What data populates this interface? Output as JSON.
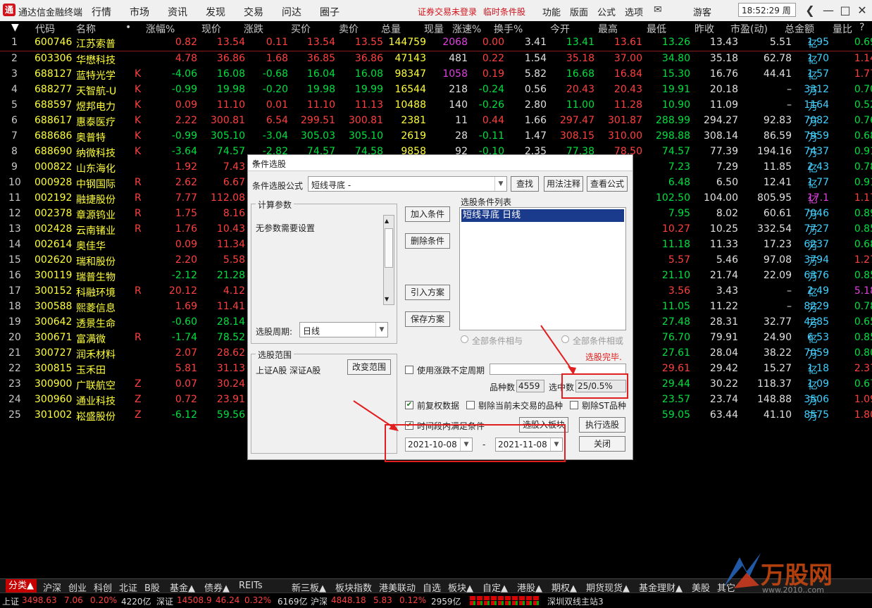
{
  "app": {
    "title": "通达信金融终端",
    "logo": "通",
    "menu": [
      "行情",
      "市场",
      "资讯",
      "发现",
      "交易",
      "问达",
      "圈子"
    ],
    "warning1": "证券交易未登录",
    "warning2": "临时条件股",
    "menu2": [
      "功能",
      "版面",
      "公式",
      "选项"
    ],
    "mail_icon": "✉",
    "guest": "游客",
    "clock": "18:52:29 周一",
    "win_back": "❮",
    "win_min": "—",
    "win_max": "□",
    "win_close": "✕"
  },
  "table": {
    "sort_marker": "▼",
    "headers": [
      "代码",
      "名称",
      "•",
      "涨幅%",
      "现价",
      "涨跌",
      "买价",
      "卖价",
      "总量",
      "现量",
      "涨速%",
      "换手%",
      "今开",
      "最高",
      "最低",
      "昨收",
      "市盈(动)",
      "总金额",
      "量比",
      "?"
    ],
    "rows": [
      {
        "no": "1",
        "code": "600746",
        "name": "江苏索普",
        "flag": "",
        "chg": "0.82",
        "price": "13.54",
        "diff": "0.11",
        "bid": "13.54",
        "ask": "13.55",
        "vol": "144759",
        "cur": "2068",
        "spd": "0.00",
        "turn": "3.41",
        "open": "13.41",
        "high": "13.61",
        "low": "13.26",
        "prev": "13.43",
        "pe": "5.51",
        "amt": "1.95",
        "amt_unit": "亿",
        "ratio": "0.69"
      },
      {
        "no": "2",
        "code": "603306",
        "name": "华懋科技",
        "flag": "",
        "chg": "4.78",
        "price": "36.86",
        "diff": "1.68",
        "bid": "36.85",
        "ask": "36.86",
        "vol": "47143",
        "cur": "481",
        "spd": "0.22",
        "turn": "1.54",
        "open": "35.18",
        "high": "37.00",
        "low": "34.80",
        "prev": "35.18",
        "pe": "62.78",
        "amt": "1.70",
        "amt_unit": "亿",
        "ratio": "1.14"
      },
      {
        "no": "3",
        "code": "688127",
        "name": "蓝特光学",
        "flag": "K",
        "chg": "-4.06",
        "price": "16.08",
        "diff": "-0.68",
        "bid": "16.04",
        "ask": "16.08",
        "vol": "98347",
        "cur": "1058",
        "spd": "0.19",
        "turn": "5.82",
        "open": "16.68",
        "high": "16.84",
        "low": "15.30",
        "prev": "16.76",
        "pe": "44.41",
        "amt": "1.57",
        "amt_unit": "亿",
        "ratio": "1.77"
      },
      {
        "no": "4",
        "code": "688277",
        "name": "天智航-U",
        "flag": "K",
        "chg": "-0.99",
        "price": "19.98",
        "diff": "-0.20",
        "bid": "19.98",
        "ask": "19.99",
        "vol": "16544",
        "cur": "218",
        "spd": "-0.24",
        "turn": "0.56",
        "open": "20.43",
        "high": "20.43",
        "low": "19.91",
        "prev": "20.18",
        "pe": "–",
        "amt": "3312",
        "amt_unit": "万",
        "ratio": "0.70"
      },
      {
        "no": "5",
        "code": "688597",
        "name": "煜邦电力",
        "flag": "K",
        "chg": "0.09",
        "price": "11.10",
        "diff": "0.01",
        "bid": "11.10",
        "ask": "11.13",
        "vol": "10488",
        "cur": "140",
        "spd": "-0.26",
        "turn": "2.80",
        "open": "11.00",
        "high": "11.28",
        "low": "10.90",
        "prev": "11.09",
        "pe": "–",
        "amt": "1164",
        "amt_unit": "万",
        "ratio": "0.52"
      },
      {
        "no": "6",
        "code": "688617",
        "name": "惠泰医疗",
        "flag": "K",
        "chg": "2.22",
        "price": "300.81",
        "diff": "6.54",
        "bid": "299.51",
        "ask": "300.81",
        "vol": "2381",
        "cur": "11",
        "spd": "0.44",
        "turn": "1.66",
        "open": "297.47",
        "high": "301.87",
        "low": "288.99",
        "prev": "294.27",
        "pe": "92.83",
        "amt": "7082",
        "amt_unit": "万",
        "ratio": "0.76"
      },
      {
        "no": "7",
        "code": "688686",
        "name": "奥普特",
        "flag": "K",
        "chg": "-0.99",
        "price": "305.10",
        "diff": "-3.04",
        "bid": "305.03",
        "ask": "305.10",
        "vol": "2619",
        "cur": "28",
        "spd": "-0.11",
        "turn": "1.47",
        "open": "308.15",
        "high": "310.00",
        "low": "298.88",
        "prev": "308.14",
        "pe": "86.59",
        "amt": "7959",
        "amt_unit": "万",
        "ratio": "0.68"
      },
      {
        "no": "8",
        "code": "688690",
        "name": "纳微科技",
        "flag": "K",
        "chg": "-3.64",
        "price": "74.57",
        "diff": "-2.82",
        "bid": "74.57",
        "ask": "74.58",
        "vol": "9858",
        "cur": "92",
        "spd": "-0.10",
        "turn": "2.35",
        "open": "77.38",
        "high": "78.50",
        "low": "74.57",
        "prev": "77.39",
        "pe": "194.16",
        "amt": "7437",
        "amt_unit": "万",
        "ratio": "0.91"
      },
      {
        "no": "9",
        "code": "000822",
        "name": "山东海化",
        "flag": "",
        "chg": "1.92",
        "price": "7.43",
        "low": "7.23",
        "prev": "7.29",
        "pe": "11.85",
        "amt": "2.43",
        "amt_unit": "亿",
        "ratio": "0.78"
      },
      {
        "no": "10",
        "code": "000928",
        "name": "中钢国际",
        "flag": "R",
        "chg": "2.62",
        "price": "6.67",
        "low": "6.48",
        "prev": "6.50",
        "pe": "12.41",
        "amt": "1.77",
        "amt_unit": "亿",
        "ratio": "0.91"
      },
      {
        "no": "11",
        "code": "002192",
        "name": "融捷股份",
        "flag": "R",
        "chg": "7.77",
        "price": "112.08",
        "low": "102.50",
        "prev": "104.00",
        "pe": "805.95",
        "amt": "17.1",
        "amt_unit": "亿",
        "ratio": "1.17"
      },
      {
        "no": "12",
        "code": "002378",
        "name": "章源钨业",
        "flag": "R",
        "chg": "1.75",
        "price": "8.16",
        "low": "7.95",
        "prev": "8.02",
        "pe": "60.61",
        "amt": "7046",
        "amt_unit": "万",
        "ratio": "0.89"
      },
      {
        "no": "13",
        "code": "002428",
        "name": "云南锗业",
        "flag": "R",
        "chg": "1.76",
        "price": "10.43",
        "low": "10.27",
        "prev": "10.25",
        "pe": "332.54",
        "amt": "7727",
        "amt_unit": "万",
        "ratio": "0.85"
      },
      {
        "no": "14",
        "code": "002614",
        "name": "奥佳华",
        "flag": "",
        "chg": "0.09",
        "price": "11.34",
        "low": "11.18",
        "prev": "11.33",
        "pe": "17.23",
        "amt": "6237",
        "amt_unit": "万",
        "ratio": "0.68"
      },
      {
        "no": "15",
        "code": "002620",
        "name": "瑞和股份",
        "flag": "",
        "chg": "2.20",
        "price": "5.58",
        "low": "5.57",
        "prev": "5.46",
        "pe": "97.08",
        "amt": "3794",
        "amt_unit": "万",
        "ratio": "1.27"
      },
      {
        "no": "16",
        "code": "300119",
        "name": "瑞普生物",
        "flag": "",
        "chg": "-2.12",
        "price": "21.28",
        "low": "21.10",
        "prev": "21.74",
        "pe": "22.09",
        "amt": "6376",
        "amt_unit": "万",
        "ratio": "0.85"
      },
      {
        "no": "17",
        "code": "300152",
        "name": "科融环境",
        "flag": "R",
        "chg": "20.12",
        "price": "4.12",
        "low": "3.56",
        "prev": "3.43",
        "pe": "–",
        "amt": "2.49",
        "amt_unit": "亿",
        "ratio": "5.18"
      },
      {
        "no": "18",
        "code": "300588",
        "name": "熙菱信息",
        "flag": "",
        "chg": "1.69",
        "price": "11.41",
        "low": "11.05",
        "prev": "11.22",
        "pe": "–",
        "amt": "8229",
        "amt_unit": "万",
        "ratio": "0.78"
      },
      {
        "no": "19",
        "code": "300642",
        "name": "透景生命",
        "flag": "",
        "chg": "-0.60",
        "price": "28.14",
        "low": "27.48",
        "prev": "28.31",
        "pe": "32.77",
        "amt": "4285",
        "amt_unit": "万",
        "ratio": "0.65"
      },
      {
        "no": "20",
        "code": "300671",
        "name": "富满微",
        "flag": "R",
        "chg": "-1.74",
        "price": "78.52",
        "low": "76.70",
        "prev": "79.91",
        "pe": "24.90",
        "amt": "6.53",
        "amt_unit": "亿",
        "ratio": "0.85"
      },
      {
        "no": "21",
        "code": "300727",
        "name": "润禾材料",
        "flag": "",
        "chg": "2.07",
        "price": "28.62",
        "low": "27.61",
        "prev": "28.04",
        "pe": "38.22",
        "amt": "7059",
        "amt_unit": "万",
        "ratio": "0.80"
      },
      {
        "no": "22",
        "code": "300815",
        "name": "玉禾田",
        "flag": "",
        "chg": "5.81",
        "price": "31.13",
        "low": "29.61",
        "prev": "29.42",
        "pe": "15.27",
        "amt": "1.18",
        "amt_unit": "亿",
        "ratio": "2.37"
      },
      {
        "no": "23",
        "code": "300900",
        "name": "广联航空",
        "flag": "Z",
        "chg": "0.07",
        "price": "30.24",
        "low": "29.44",
        "prev": "30.22",
        "pe": "118.37",
        "amt": "1.09",
        "amt_unit": "亿",
        "ratio": "0.67"
      },
      {
        "no": "24",
        "code": "300960",
        "name": "通业科技",
        "flag": "Z",
        "chg": "0.72",
        "price": "23.91",
        "low": "23.57",
        "prev": "23.74",
        "pe": "148.88",
        "amt": "3506",
        "amt_unit": "万",
        "ratio": "1.09"
      },
      {
        "no": "25",
        "code": "301002",
        "name": "崧盛股份",
        "flag": "Z",
        "chg": "-6.12",
        "price": "59.56",
        "low": "59.05",
        "prev": "63.44",
        "pe": "41.10",
        "amt": "8575",
        "amt_unit": "万",
        "ratio": "1.80"
      }
    ]
  },
  "dialog": {
    "title": "条件选股",
    "min_label": "—",
    "close_label": "✕",
    "formula_label": "条件选股公式",
    "formula_value": "短线寻底      -",
    "find_btn": "查找",
    "usage_btn": "用法注释",
    "view_btn": "查看公式",
    "params_group": "计算参数",
    "no_params": "无参数需要设置",
    "add_btn": "加入条件",
    "del_btn": "删除条件",
    "import_btn": "引入方案",
    "save_btn": "保存方案",
    "list_title": "选股条件列表",
    "list_item": "短线寻底  日线",
    "period_label": "选股周期:",
    "period_value": "日线",
    "radio_and": "全部条件相与",
    "radio_or": "全部条件相或",
    "done_text": "选股完毕.",
    "range_group": "选股范围",
    "range_text": "上证A股 深证A股",
    "change_range_btn": "改变范围",
    "use_uncertain_label": "使用涨跌不定周期",
    "count_label": "品种数",
    "count_value": "4559",
    "selected_label": "选中数",
    "selected_value": "25/0.5%",
    "fq_label": "前复权数据",
    "exclude_label": "剔除当前未交易的品种",
    "st_label": "剔除ST品种",
    "timerange_label": "时间段内满足条件",
    "to_board_btn": "选股入板块",
    "run_btn": "执行选股",
    "close_btn": "关闭",
    "date_from": "2021-10-08",
    "date_sep": "-",
    "date_to": "2021-11-08"
  },
  "bottom_tabs": [
    "分类▲",
    "沪深",
    "创业",
    "科创",
    "北证",
    "B股",
    "基金▲",
    "债券▲",
    "REITs",
    "新三板▲",
    "板块指数",
    "港美联动",
    "自选",
    "板块▲",
    "自定▲",
    "港股▲",
    "期权▲",
    "期货现货▲",
    "基金理财▲",
    "美股",
    "其它"
  ],
  "status": {
    "sh_label": "上证",
    "sh_val": "3498.63",
    "sh_chg": "7.06",
    "sh_pct": "0.20%",
    "sh_amt": "4220亿",
    "sz_label": "深证",
    "sz_val": "14508.9",
    "sz_chg": "46.24",
    "sz_pct": "0.32%",
    "sz_amt": "6169亿",
    "hs_label": "沪深",
    "hs_val": "4848.18",
    "hs_chg": "5.83",
    "hs_pct": "0.12%",
    "hs_amt": "2959亿",
    "server": "深圳双线主站3"
  },
  "watermark": {
    "brand": "万股网",
    "url": "www.2010..com"
  },
  "colors": {
    "up": "#ff4040",
    "down": "#00e040",
    "accent": "#c40000",
    "highlight_box": "#e02020"
  }
}
